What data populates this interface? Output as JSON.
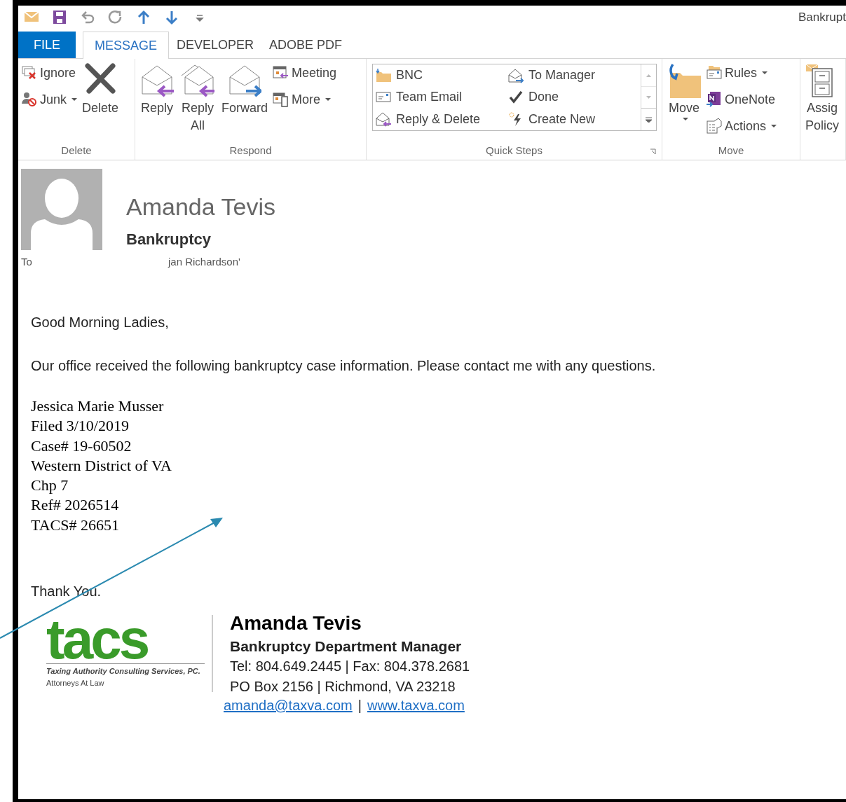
{
  "window": {
    "title": "Bankrupt"
  },
  "tabs": [
    {
      "label": "FILE",
      "kind": "file",
      "selected": false
    },
    {
      "label": "MESSAGE",
      "kind": "tab",
      "selected": true
    },
    {
      "label": "DEVELOPER",
      "kind": "tab",
      "selected": false
    },
    {
      "label": "ADOBE PDF",
      "kind": "tab",
      "selected": false
    }
  ],
  "ribbon": [
    {
      "label": "Delete",
      "items": [
        {
          "kind": "small",
          "label": "Ignore",
          "dropdown": false
        },
        {
          "kind": "small",
          "label": "Junk",
          "dropdown": true
        },
        {
          "kind": "large",
          "label": "Delete",
          "dropdown": false
        }
      ]
    },
    {
      "label": "Respond",
      "items": [
        {
          "kind": "large",
          "label": "Reply",
          "dropdown": false
        },
        {
          "kind": "large",
          "label": "Reply\nAll",
          "dropdown": false
        },
        {
          "kind": "large",
          "label": "Forward",
          "dropdown": false
        },
        {
          "kind": "small",
          "label": "Meeting",
          "dropdown": false
        },
        {
          "kind": "small",
          "label": "More",
          "dropdown": true
        }
      ]
    },
    {
      "label": "Quick Steps",
      "items": [
        {
          "kind": "gallery",
          "label": "BNC"
        },
        {
          "kind": "gallery",
          "label": "Team Email"
        },
        {
          "kind": "gallery",
          "label": "Reply & Delete"
        },
        {
          "kind": "gallery",
          "label": "To Manager"
        },
        {
          "kind": "gallery",
          "label": "Done"
        },
        {
          "kind": "gallery",
          "label": "Create New"
        }
      ]
    },
    {
      "label": "Move",
      "items": [
        {
          "kind": "large",
          "label": "Move",
          "dropdown": true
        },
        {
          "kind": "small",
          "label": "Rules",
          "dropdown": true
        },
        {
          "kind": "small",
          "label": "OneNote",
          "dropdown": false
        },
        {
          "kind": "small",
          "label": "Actions",
          "dropdown": true
        }
      ]
    },
    {
      "items": [
        {
          "kind": "large",
          "label": "Assig\nPolicy",
          "dropdown": false
        }
      ]
    }
  ],
  "message": {
    "sender": "Amanda Tevis",
    "subject": "Bankruptcy",
    "to_label": "To",
    "to_value": "jan Richardson'"
  },
  "body": {
    "greeting": "Good Morning Ladies,",
    "paragraph": "Our office received the following bankruptcy case information. Please contact me with any questions.",
    "details": [
      "Jessica Marie Musser",
      "Filed 3/10/2019",
      "Case# 19-60502",
      "Western District of VA",
      "Chp 7",
      "Ref# 2026514",
      "TACS# 26651"
    ],
    "closing": "Thank You."
  },
  "signature": {
    "logo": "tacs",
    "logo_tagline": "Taxing Authority Consulting Services, PC.",
    "logo_subline": "Attorneys At Law",
    "name": "Amanda Tevis",
    "title": "Bankruptcy Department Manager",
    "phone": "Tel: 804.649.2445 | Fax: 804.378.2681",
    "address": "PO Box 2156 | Richmond, VA 23218",
    "email": "amanda@taxva.com",
    "separator": "|",
    "website": "www.taxva.com"
  }
}
